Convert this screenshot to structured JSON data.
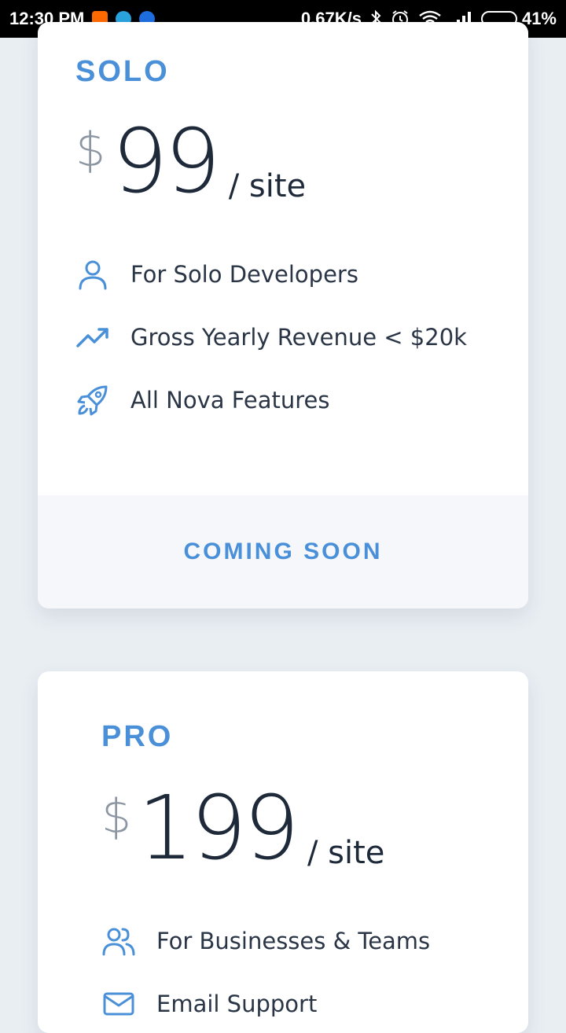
{
  "status_bar": {
    "time": "12:30 PM",
    "net_speed": "0.67K/s",
    "battery_percent_label": "41%",
    "battery_level": 0.41,
    "left_icons": [
      "mi-app-icon",
      "telegram-icon",
      "sync-icon"
    ],
    "right_icons": [
      "bluetooth-icon",
      "alarm-icon",
      "wifi-icon",
      "signal-icon",
      "battery-icon"
    ]
  },
  "plans": [
    {
      "name": "SOLO",
      "currency": "$",
      "amount": "99",
      "unit": "/ site",
      "features": [
        {
          "icon": "user-icon",
          "text": "For Solo Developers"
        },
        {
          "icon": "trending-up-icon",
          "text": "Gross Yearly Revenue < $20k"
        },
        {
          "icon": "rocket-icon",
          "text": "All Nova Features"
        }
      ],
      "cta": "COMING SOON"
    },
    {
      "name": "PRO",
      "currency": "$",
      "amount": "199",
      "unit": "/ site",
      "features": [
        {
          "icon": "users-icon",
          "text": "For Businesses & Teams"
        },
        {
          "icon": "mail-icon",
          "text": "Email Support"
        }
      ]
    }
  ],
  "colors": {
    "accent": "#4a90d9",
    "text_dark": "#1e2a3a",
    "text_muted": "#8c96a3",
    "page_bg": "#e9eef3",
    "card_bg": "#ffffff",
    "footer_bg": "#f5f7fa"
  }
}
